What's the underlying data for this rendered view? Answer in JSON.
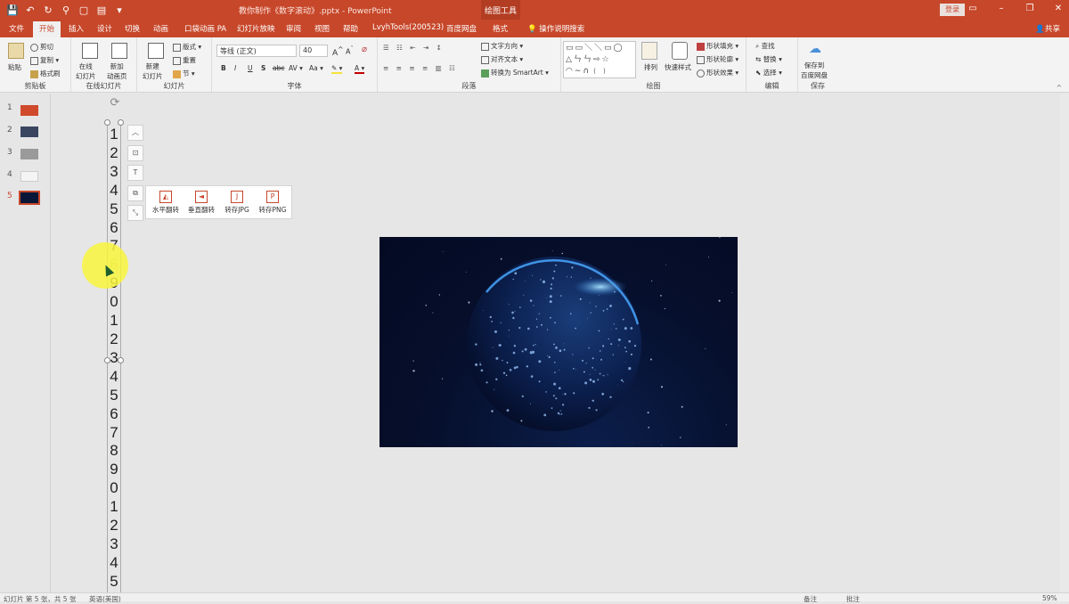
{
  "title_bar": {
    "doc_title": "教你制作《数字滚动》.pptx - PowerPoint",
    "context_tool": "绘图工具",
    "login": "登录",
    "qat_icons": [
      "save-icon",
      "undo-icon",
      "redo-icon",
      "format-painter-icon",
      "new-icon",
      "open-icon",
      "more-icon"
    ]
  },
  "tabs": [
    "文件",
    "开始",
    "插入",
    "设计",
    "切换",
    "动画",
    "口袋动画 PA",
    "幻灯片放映",
    "审阅",
    "视图",
    "帮助",
    "LvyhTools(200523)",
    "百度网盘",
    "格式",
    "操作说明搜索"
  ],
  "active_tab": "开始",
  "share_label": "共享",
  "ribbon": {
    "clipboard": {
      "label": "剪贴板",
      "paste": "粘贴",
      "cut": "剪切",
      "copy": "复制",
      "painter": "格式刷"
    },
    "online_slides": {
      "label": "在线幻灯片",
      "online": "在线\n幻灯片",
      "new_anim": "新加\n动画页"
    },
    "slides": {
      "label": "幻灯片",
      "new_slide": "新建\n幻灯片",
      "layout": "版式",
      "reset": "重置",
      "section": "节"
    },
    "font": {
      "label": "字体",
      "family": "等线 (正文)",
      "size": "40",
      "bold": "B",
      "italic": "I",
      "underline": "U",
      "strike": "S",
      "abc": "abc",
      "av": "AV",
      "aa": "Aa",
      "a": "A"
    },
    "paragraph": {
      "label": "段落",
      "text_dir": "文字方向",
      "align_text": "对齐文本",
      "smartart": "转换为 SmartArt"
    },
    "drawing": {
      "label": "绘图",
      "arrange": "排列",
      "quick_styles": "快速样式",
      "shape_fill": "形状填充",
      "shape_outline": "形状轮廓",
      "shape_effects": "形状效果"
    },
    "editing": {
      "label": "编辑",
      "find": "查找",
      "replace": "替换",
      "select": "选择"
    },
    "save": {
      "label": "保存",
      "save_to": "保存到\n百度网盘"
    }
  },
  "thumbnails": [
    {
      "num": "1",
      "color": "#d04a2c"
    },
    {
      "num": "2",
      "color": "#3a4660"
    },
    {
      "num": "3",
      "color": "#9a9a9a"
    },
    {
      "num": "4",
      "color": "#f4f4f4"
    },
    {
      "num": "5",
      "color": "#0a1638"
    }
  ],
  "selected_slide": "5",
  "textbox_digits": [
    "1",
    "2",
    "3",
    "4",
    "5",
    "6",
    "7",
    "8",
    "9",
    "0",
    "1",
    "2",
    "3",
    "4",
    "5",
    "6",
    "7",
    "8",
    "9",
    "0",
    "1",
    "2",
    "3",
    "4",
    "5"
  ],
  "image_popup": {
    "buttons": [
      {
        "label": "水平翻转",
        "icon": "flip-horizontal-icon"
      },
      {
        "label": "垂直翻转",
        "icon": "flip-vertical-icon"
      },
      {
        "label": "转存JPG",
        "icon": "J"
      },
      {
        "label": "转存PNG",
        "icon": "P"
      }
    ]
  },
  "status": {
    "slide_info": "幻灯片 第 5 张，共 5 张",
    "lang": "英语(美国)",
    "notes": "备注",
    "comments": "批注",
    "zoom": "59%"
  }
}
